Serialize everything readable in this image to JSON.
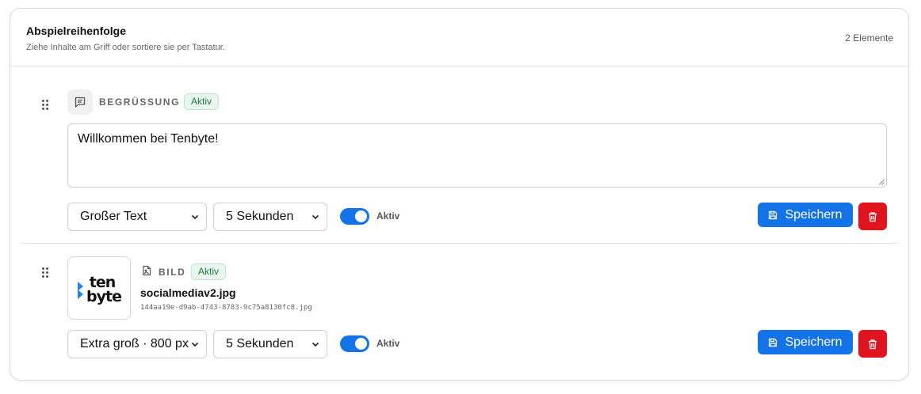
{
  "header": {
    "title": "Abspielreihenfolge",
    "subtitle": "Ziehe Inhalte am Griff oder sortiere sie per Tastatur.",
    "count": "2 Elemente"
  },
  "items": [
    {
      "type_label": "BEGRÜSSUNG",
      "type_icon": "message-square-text-icon",
      "status_badge": "Aktiv",
      "text_value": "Willkommen bei Tenbyte!",
      "size_select": "Großer Text",
      "duration_select": "5 Sekunden",
      "toggle_on": true,
      "toggle_label": "Aktiv",
      "save_label": "Speichern"
    },
    {
      "type_label": "BILD",
      "type_icon": "file-image-icon",
      "status_badge": "Aktiv",
      "thumbnail_logo_text": "tenbyte",
      "filename": "socialmediav2.jpg",
      "uuid": "144aa19e-d9ab-4743-8783-9c75a8130fc8.jpg",
      "size_select": "Extra groß · 800 px",
      "duration_select": "5 Sekunden",
      "toggle_on": true,
      "toggle_label": "Aktiv",
      "save_label": "Speichern"
    }
  ],
  "colors": {
    "primary": "#1473e6",
    "danger": "#e0141e",
    "badge_text": "#1c7a3c",
    "badge_bg": "#eaf7ee",
    "logo_accent": "#1e88e5"
  }
}
